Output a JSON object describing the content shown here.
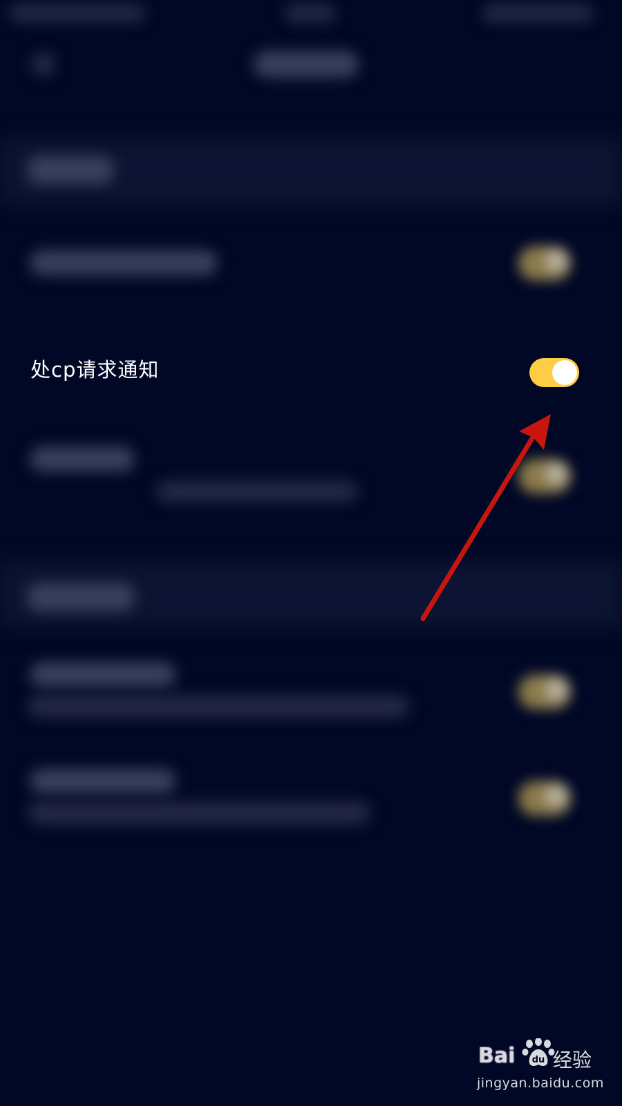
{
  "screen": {
    "background": "#010826"
  },
  "setting": {
    "label": "处cp请求通知",
    "toggle_state": "on",
    "toggle_color": "#ffcc45"
  },
  "annotation": {
    "arrow_color": "#c8160f",
    "arrow_icon": "red-arrow-icon"
  },
  "watermark": {
    "brand": "Bai",
    "paw_icon": "baidu-paw-icon",
    "brand_cn": "经验",
    "url": "jingyan.baidu.com"
  }
}
